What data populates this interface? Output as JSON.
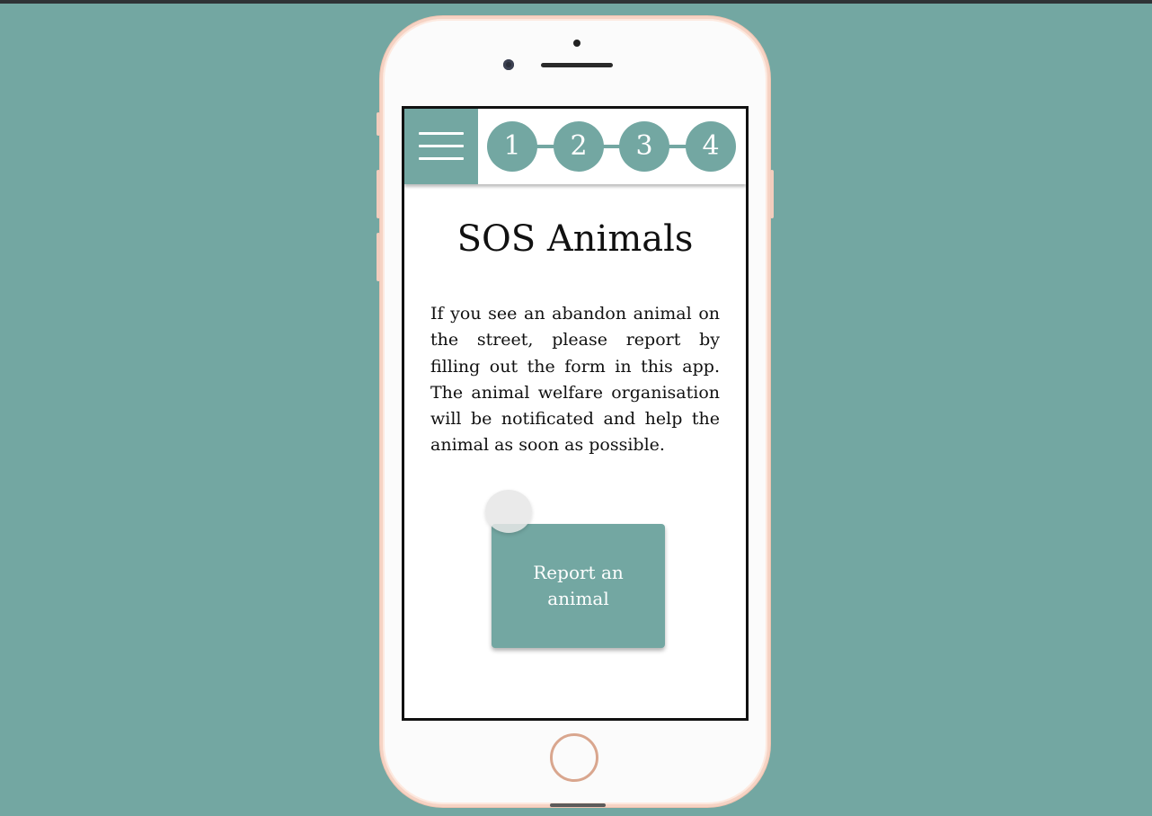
{
  "app": {
    "title": "SOS Animals",
    "description": "If you see an abandon animal on the street, please report by filling out the form in this app. The animal welfare organi­sation will be notificated and help the animal as soon as possible."
  },
  "header": {
    "menu_icon": "hamburger-menu-icon",
    "steps": [
      {
        "label": "1"
      },
      {
        "label": "2"
      },
      {
        "label": "3"
      },
      {
        "label": "4"
      }
    ]
  },
  "actions": {
    "report_label": "Report an animal"
  },
  "colors": {
    "accent": "#73a7a2",
    "background": "#73a7a2",
    "screen": "#ffffff",
    "text": "#111111"
  }
}
